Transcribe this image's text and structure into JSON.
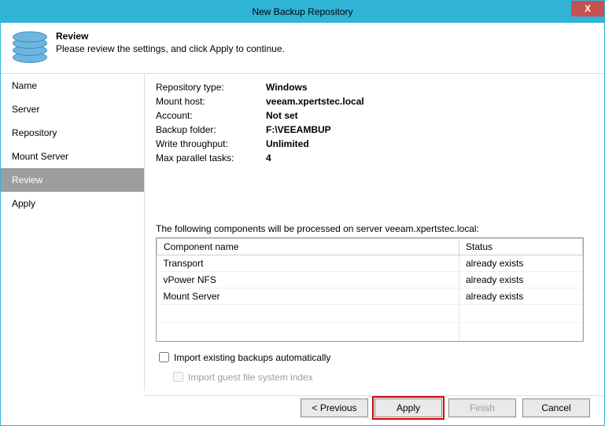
{
  "window": {
    "title": "New Backup Repository",
    "close_glyph": "X"
  },
  "header": {
    "title": "Review",
    "subtitle": "Please review the settings, and click Apply to continue."
  },
  "sidebar": {
    "items": [
      {
        "label": "Name"
      },
      {
        "label": "Server"
      },
      {
        "label": "Repository"
      },
      {
        "label": "Mount Server"
      },
      {
        "label": "Review"
      },
      {
        "label": "Apply"
      }
    ]
  },
  "summary": {
    "rows": [
      {
        "label": "Repository type:",
        "value": "Windows"
      },
      {
        "label": "Mount host:",
        "value": "veeam.xpertstec.local"
      },
      {
        "label": "Account:",
        "value": "Not set"
      },
      {
        "label": "Backup folder:",
        "value": "F:\\VEEAMBUP"
      },
      {
        "label": "Write throughput:",
        "value": "Unlimited"
      },
      {
        "label": "Max parallel tasks:",
        "value": "4"
      }
    ]
  },
  "components": {
    "intro": "The following components will be processed on server veeam.xpertstec.local:",
    "headers": {
      "name": "Component name",
      "status": "Status"
    },
    "rows": [
      {
        "name": "Transport",
        "status": "already exists"
      },
      {
        "name": "vPower NFS",
        "status": "already exists"
      },
      {
        "name": "Mount Server",
        "status": "already exists"
      }
    ]
  },
  "options": {
    "import_backups": "Import existing backups automatically",
    "import_index": "Import guest file system index"
  },
  "buttons": {
    "previous": "< Previous",
    "apply": "Apply",
    "finish": "Finish",
    "cancel": "Cancel"
  }
}
